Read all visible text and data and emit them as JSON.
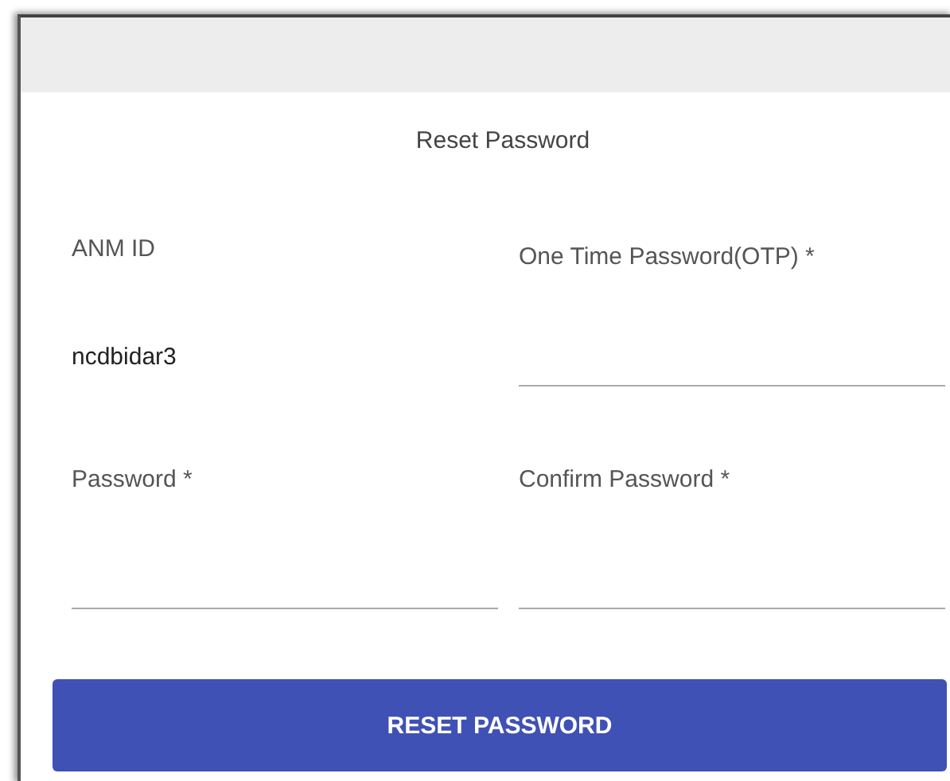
{
  "dialog": {
    "title": "Reset Password"
  },
  "fields": [
    {
      "kind": "readonly",
      "label": "ANM ID",
      "value": "ncdbidar3"
    },
    {
      "kind": "input",
      "label": "One Time Password(OTP) *"
    },
    {
      "kind": "input",
      "label": "Password *"
    },
    {
      "kind": "input",
      "label": "Confirm Password *"
    }
  ],
  "button": {
    "label": "RESET PASSWORD"
  }
}
